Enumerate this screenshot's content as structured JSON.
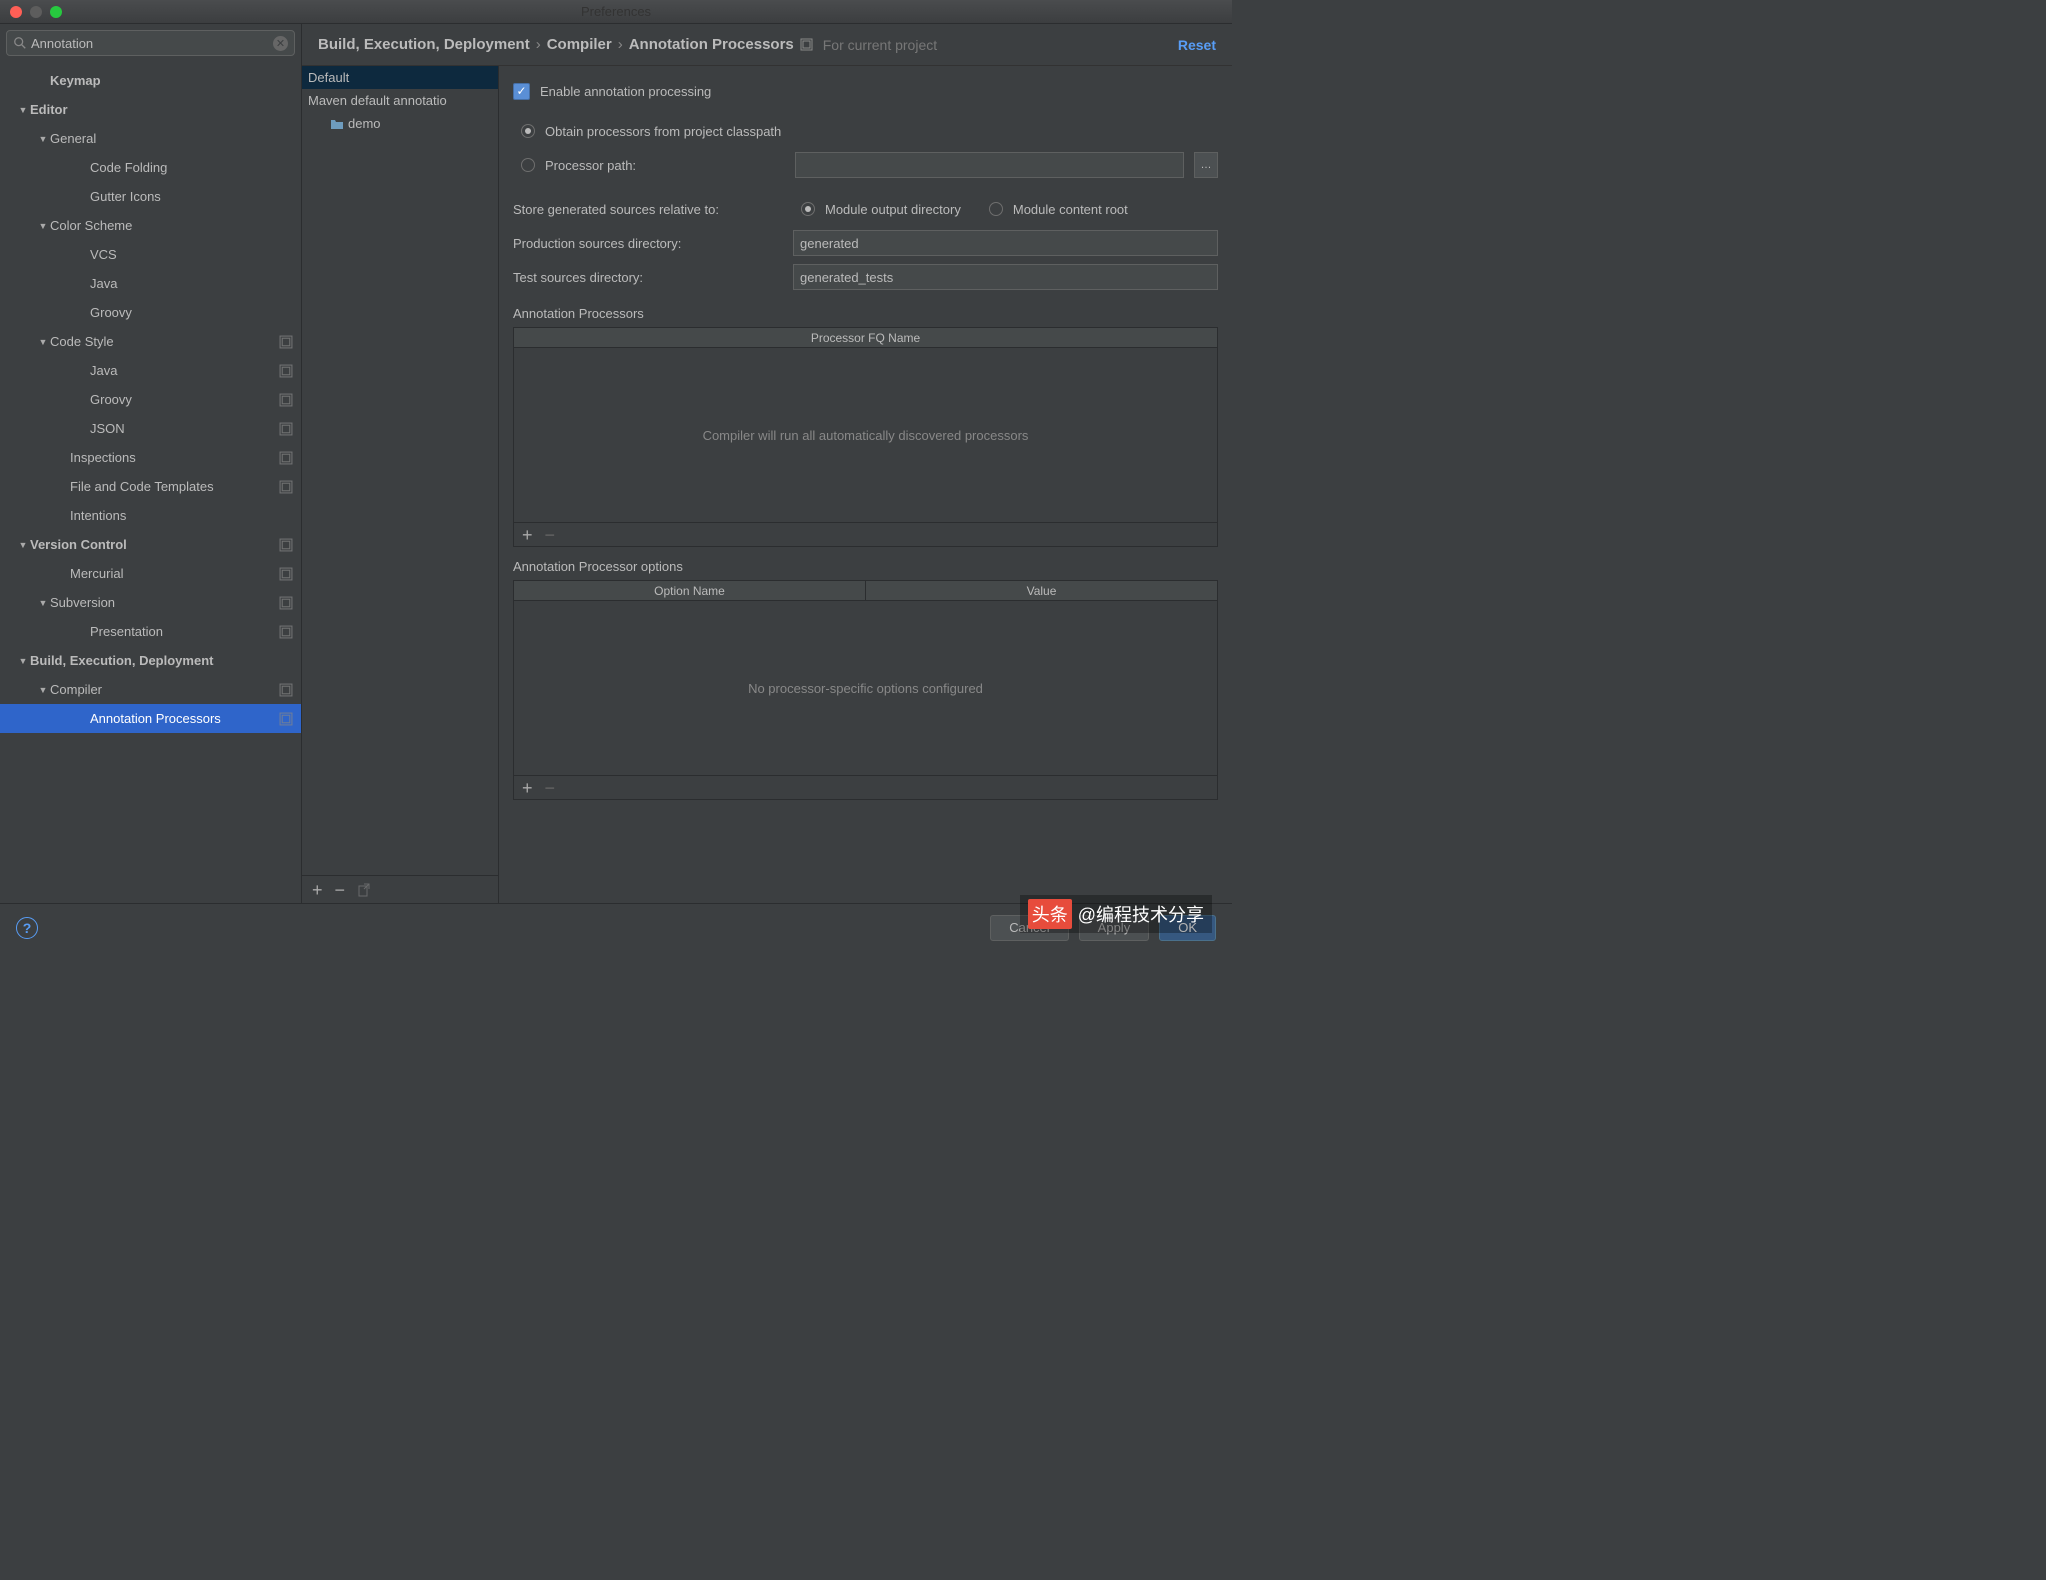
{
  "window": {
    "title": "Preferences"
  },
  "search": {
    "value": "Annotation"
  },
  "sidebar": {
    "items": [
      {
        "label": "Keymap",
        "indent": 36,
        "bold": true,
        "arrow": ""
      },
      {
        "label": "Editor",
        "indent": 16,
        "bold": true,
        "arrow": "▼"
      },
      {
        "label": "General",
        "indent": 36,
        "bold": false,
        "arrow": "▼"
      },
      {
        "label": "Code Folding",
        "indent": 76,
        "bold": false,
        "arrow": ""
      },
      {
        "label": "Gutter Icons",
        "indent": 76,
        "bold": false,
        "arrow": ""
      },
      {
        "label": "Color Scheme",
        "indent": 36,
        "bold": false,
        "arrow": "▼"
      },
      {
        "label": "VCS",
        "indent": 76,
        "bold": false,
        "arrow": ""
      },
      {
        "label": "Java",
        "indent": 76,
        "bold": false,
        "arrow": ""
      },
      {
        "label": "Groovy",
        "indent": 76,
        "bold": false,
        "arrow": ""
      },
      {
        "label": "Code Style",
        "indent": 36,
        "bold": false,
        "arrow": "▼",
        "badge": true
      },
      {
        "label": "Java",
        "indent": 76,
        "bold": false,
        "arrow": "",
        "badge": true
      },
      {
        "label": "Groovy",
        "indent": 76,
        "bold": false,
        "arrow": "",
        "badge": true
      },
      {
        "label": "JSON",
        "indent": 76,
        "bold": false,
        "arrow": "",
        "badge": true
      },
      {
        "label": "Inspections",
        "indent": 56,
        "bold": false,
        "arrow": "",
        "badge": true
      },
      {
        "label": "File and Code Templates",
        "indent": 56,
        "bold": false,
        "arrow": "",
        "badge": true
      },
      {
        "label": "Intentions",
        "indent": 56,
        "bold": false,
        "arrow": ""
      },
      {
        "label": "Version Control",
        "indent": 16,
        "bold": true,
        "arrow": "▼",
        "badge": true
      },
      {
        "label": "Mercurial",
        "indent": 56,
        "bold": false,
        "arrow": "",
        "badge": true
      },
      {
        "label": "Subversion",
        "indent": 36,
        "bold": false,
        "arrow": "▼",
        "badge": true
      },
      {
        "label": "Presentation",
        "indent": 76,
        "bold": false,
        "arrow": "",
        "badge": true
      },
      {
        "label": "Build, Execution, Deployment",
        "indent": 16,
        "bold": true,
        "arrow": "▼"
      },
      {
        "label": "Compiler",
        "indent": 36,
        "bold": false,
        "arrow": "▼",
        "badge": true
      },
      {
        "label": "Annotation Processors",
        "indent": 76,
        "bold": false,
        "arrow": "",
        "badge": true,
        "selected": true
      }
    ]
  },
  "breadcrumb": {
    "part1": "Build, Execution, Deployment",
    "part2": "Compiler",
    "part3": "Annotation Processors",
    "suffix": "For current project",
    "reset": "Reset"
  },
  "profiles": {
    "items": [
      {
        "label": "Default",
        "selected": true
      },
      {
        "label": "Maven default annotatio"
      },
      {
        "label": "demo",
        "sub": true
      }
    ]
  },
  "form": {
    "enable_label": "Enable annotation processing",
    "obtain_label": "Obtain processors from project classpath",
    "path_label": "Processor path:",
    "path_value": "",
    "store_label": "Store generated sources relative to:",
    "module_output": "Module output directory",
    "module_content": "Module content root",
    "prod_label": "Production sources directory:",
    "prod_value": "generated",
    "test_label": "Test sources directory:",
    "test_value": "generated_tests"
  },
  "processors": {
    "title": "Annotation Processors",
    "header": "Processor FQ Name",
    "empty": "Compiler will run all automatically discovered processors"
  },
  "options": {
    "title": "Annotation Processor options",
    "header1": "Option Name",
    "header2": "Value",
    "empty": "No processor-specific options configured"
  },
  "footer": {
    "cancel": "Cancel",
    "apply": "Apply",
    "ok": "OK"
  },
  "watermark": {
    "prefix": "头条",
    "text": "@编程技术分享"
  }
}
